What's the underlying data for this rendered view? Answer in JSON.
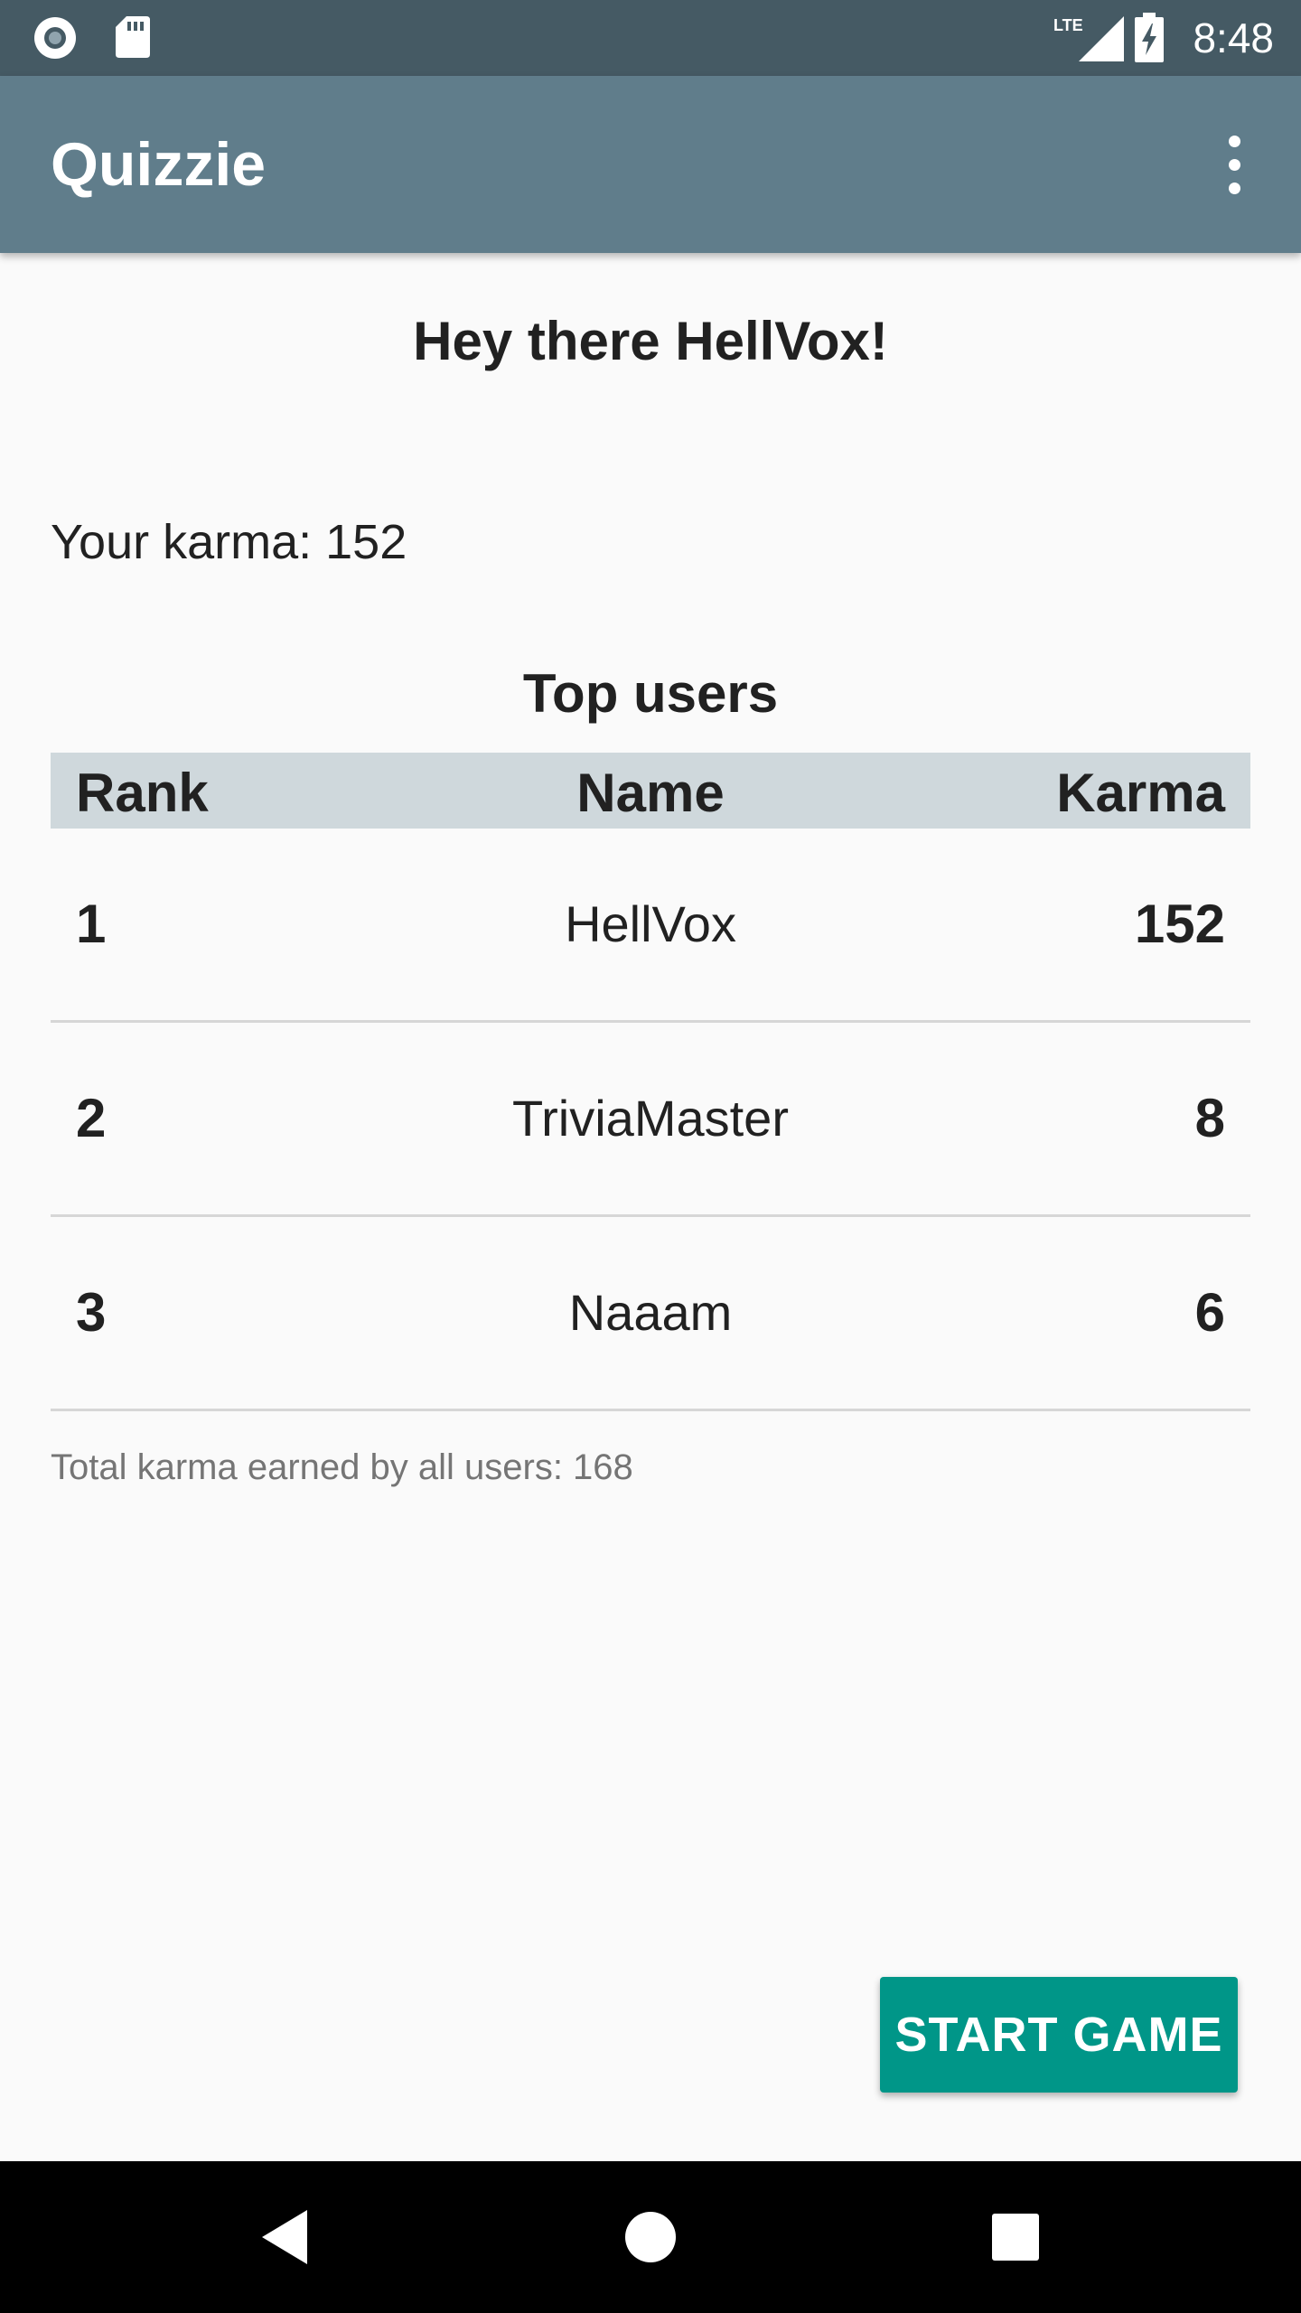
{
  "status_bar": {
    "time": "8:48",
    "network": "LTE",
    "icons": [
      "sync-circle-icon",
      "sd-card-icon",
      "lte-signal-icon",
      "battery-charging-icon"
    ]
  },
  "app_bar": {
    "title": "Quizzie",
    "menu_icon": "more-vert-icon"
  },
  "main": {
    "greeting": "Hey there HellVox!",
    "karma_text": "Your karma: 152",
    "top_users_title": "Top users",
    "table": {
      "headers": {
        "rank": "Rank",
        "name": "Name",
        "karma": "Karma"
      },
      "rows": [
        {
          "rank": "1",
          "name": "HellVox",
          "karma": "152"
        },
        {
          "rank": "2",
          "name": "TriviaMaster",
          "karma": "8"
        },
        {
          "rank": "3",
          "name": "Naaam",
          "karma": "6"
        }
      ]
    },
    "total_karma_text": "Total karma earned by all users: 168"
  },
  "actions": {
    "start_game_label": "START GAME"
  },
  "nav_bar": {
    "buttons": [
      "back-icon",
      "home-icon",
      "recents-icon"
    ]
  },
  "colors": {
    "status_bar": "#455a64",
    "app_bar": "#607d8b",
    "table_header": "#cfd8dc",
    "accent": "#009688",
    "background": "#fafafa"
  }
}
